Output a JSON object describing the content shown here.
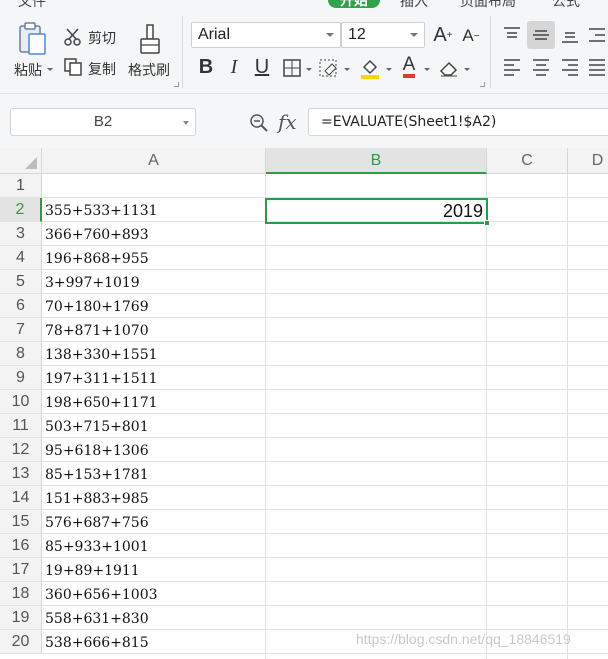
{
  "tabs": [
    "文件",
    "开始",
    "插入",
    "页面布局",
    "公式"
  ],
  "active_tab": "开始",
  "clipboard": {
    "paste": "粘贴",
    "cut": "剪切",
    "copy": "复制",
    "format_painter": "格式刷"
  },
  "font": {
    "name": "Arial",
    "size": "12"
  },
  "name_box": "B2",
  "formula_bar": {
    "fx": "fx",
    "formula": "=EVALUATE(Sheet1!$A2)"
  },
  "columns": [
    "A",
    "B",
    "C",
    "D"
  ],
  "rows": [
    {
      "num": "1",
      "a": ""
    },
    {
      "num": "2",
      "a": "355+533+1131"
    },
    {
      "num": "3",
      "a": "366+760+893"
    },
    {
      "num": "4",
      "a": "196+868+955"
    },
    {
      "num": "5",
      "a": "3+997+1019"
    },
    {
      "num": "6",
      "a": "70+180+1769"
    },
    {
      "num": "7",
      "a": "78+871+1070"
    },
    {
      "num": "8",
      "a": "138+330+1551"
    },
    {
      "num": "9",
      "a": "197+311+1511"
    },
    {
      "num": "10",
      "a": "198+650+1171"
    },
    {
      "num": "11",
      "a": "503+715+801"
    },
    {
      "num": "12",
      "a": "95+618+1306"
    },
    {
      "num": "13",
      "a": "85+153+1781"
    },
    {
      "num": "14",
      "a": "151+883+985"
    },
    {
      "num": "15",
      "a": "576+687+756"
    },
    {
      "num": "16",
      "a": "85+933+1001"
    },
    {
      "num": "17",
      "a": "19+89+1911"
    },
    {
      "num": "18",
      "a": "360+656+1003"
    },
    {
      "num": "19",
      "a": "558+631+830"
    },
    {
      "num": "20",
      "a": "538+666+815"
    }
  ],
  "selected_cell": {
    "ref": "B2",
    "value": "2019"
  },
  "watermark": "https://blog.csdn.net/qq_18846519",
  "colors": {
    "accent": "#2d9a45",
    "ribbon_bg": "#f5f6f7",
    "grid_line": "#e2e2e2"
  }
}
